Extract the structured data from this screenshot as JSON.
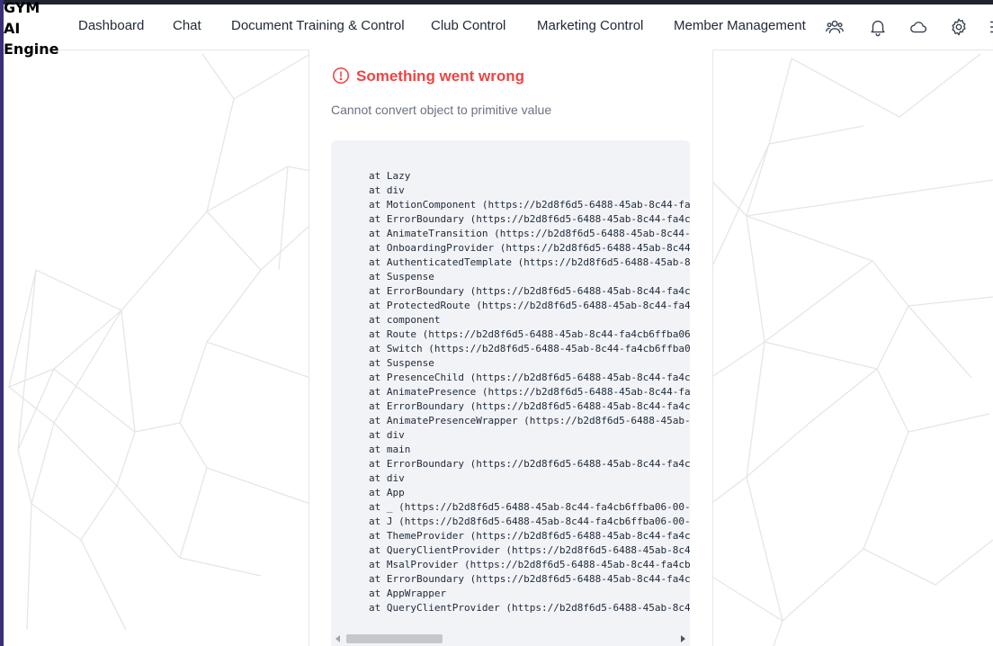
{
  "brand": {
    "lines": [
      "GYM",
      "AI",
      "Engine"
    ]
  },
  "nav": [
    {
      "label": "Dashboard"
    },
    {
      "label": "Chat"
    },
    {
      "label": "Document Training & Control"
    },
    {
      "label": "Club Control"
    },
    {
      "label": "Marketing Control"
    },
    {
      "label": "Member Management"
    }
  ],
  "header_icons": [
    "users-icon",
    "bell-icon",
    "cloud-icon",
    "gear-icon",
    "menu-icon"
  ],
  "error": {
    "title": "Something went wrong",
    "message": "Cannot convert object to primitive value",
    "icon": "exclamation-circle-icon",
    "color": "#ef4444",
    "stack": [
      "at Lazy",
      "at div",
      "at MotionComponent (https://b2d8f6d5-6488-45ab-8c44-fa",
      "at ErrorBoundary (https://b2d8f6d5-6488-45ab-8c44-fa4c",
      "at AnimateTransition (https://b2d8f6d5-6488-45ab-8c44-",
      "at OnboardingProvider (https://b2d8f6d5-6488-45ab-8c44",
      "at AuthenticatedTemplate (https://b2d8f6d5-6488-45ab-8",
      "at Suspense",
      "at ErrorBoundary (https://b2d8f6d5-6488-45ab-8c44-fa4c",
      "at ProtectedRoute (https://b2d8f6d5-6488-45ab-8c44-fa4",
      "at component",
      "at Route (https://b2d8f6d5-6488-45ab-8c44-fa4cb6ffba06",
      "at Switch (https://b2d8f6d5-6488-45ab-8c44-fa4cb6ffba0",
      "at Suspense",
      "at PresenceChild (https://b2d8f6d5-6488-45ab-8c44-fa4c",
      "at AnimatePresence (https://b2d8f6d5-6488-45ab-8c44-fa",
      "at ErrorBoundary (https://b2d8f6d5-6488-45ab-8c44-fa4c",
      "at AnimatePresenceWrapper (https://b2d8f6d5-6488-45ab-",
      "at div",
      "at main",
      "at ErrorBoundary (https://b2d8f6d5-6488-45ab-8c44-fa4c",
      "at div",
      "at App",
      "at _ (https://b2d8f6d5-6488-45ab-8c44-fa4cb6ffba06-00-",
      "at J (https://b2d8f6d5-6488-45ab-8c44-fa4cb6ffba06-00-",
      "at ThemeProvider (https://b2d8f6d5-6488-45ab-8c44-fa4c",
      "at QueryClientProvider (https://b2d8f6d5-6488-45ab-8c4",
      "at MsalProvider (https://b2d8f6d5-6488-45ab-8c44-fa4cb",
      "at ErrorBoundary (https://b2d8f6d5-6488-45ab-8c44-fa4c",
      "at AppWrapper",
      "at QueryClientProvider (https://b2d8f6d5-6488-45ab-8c4"
    ]
  }
}
